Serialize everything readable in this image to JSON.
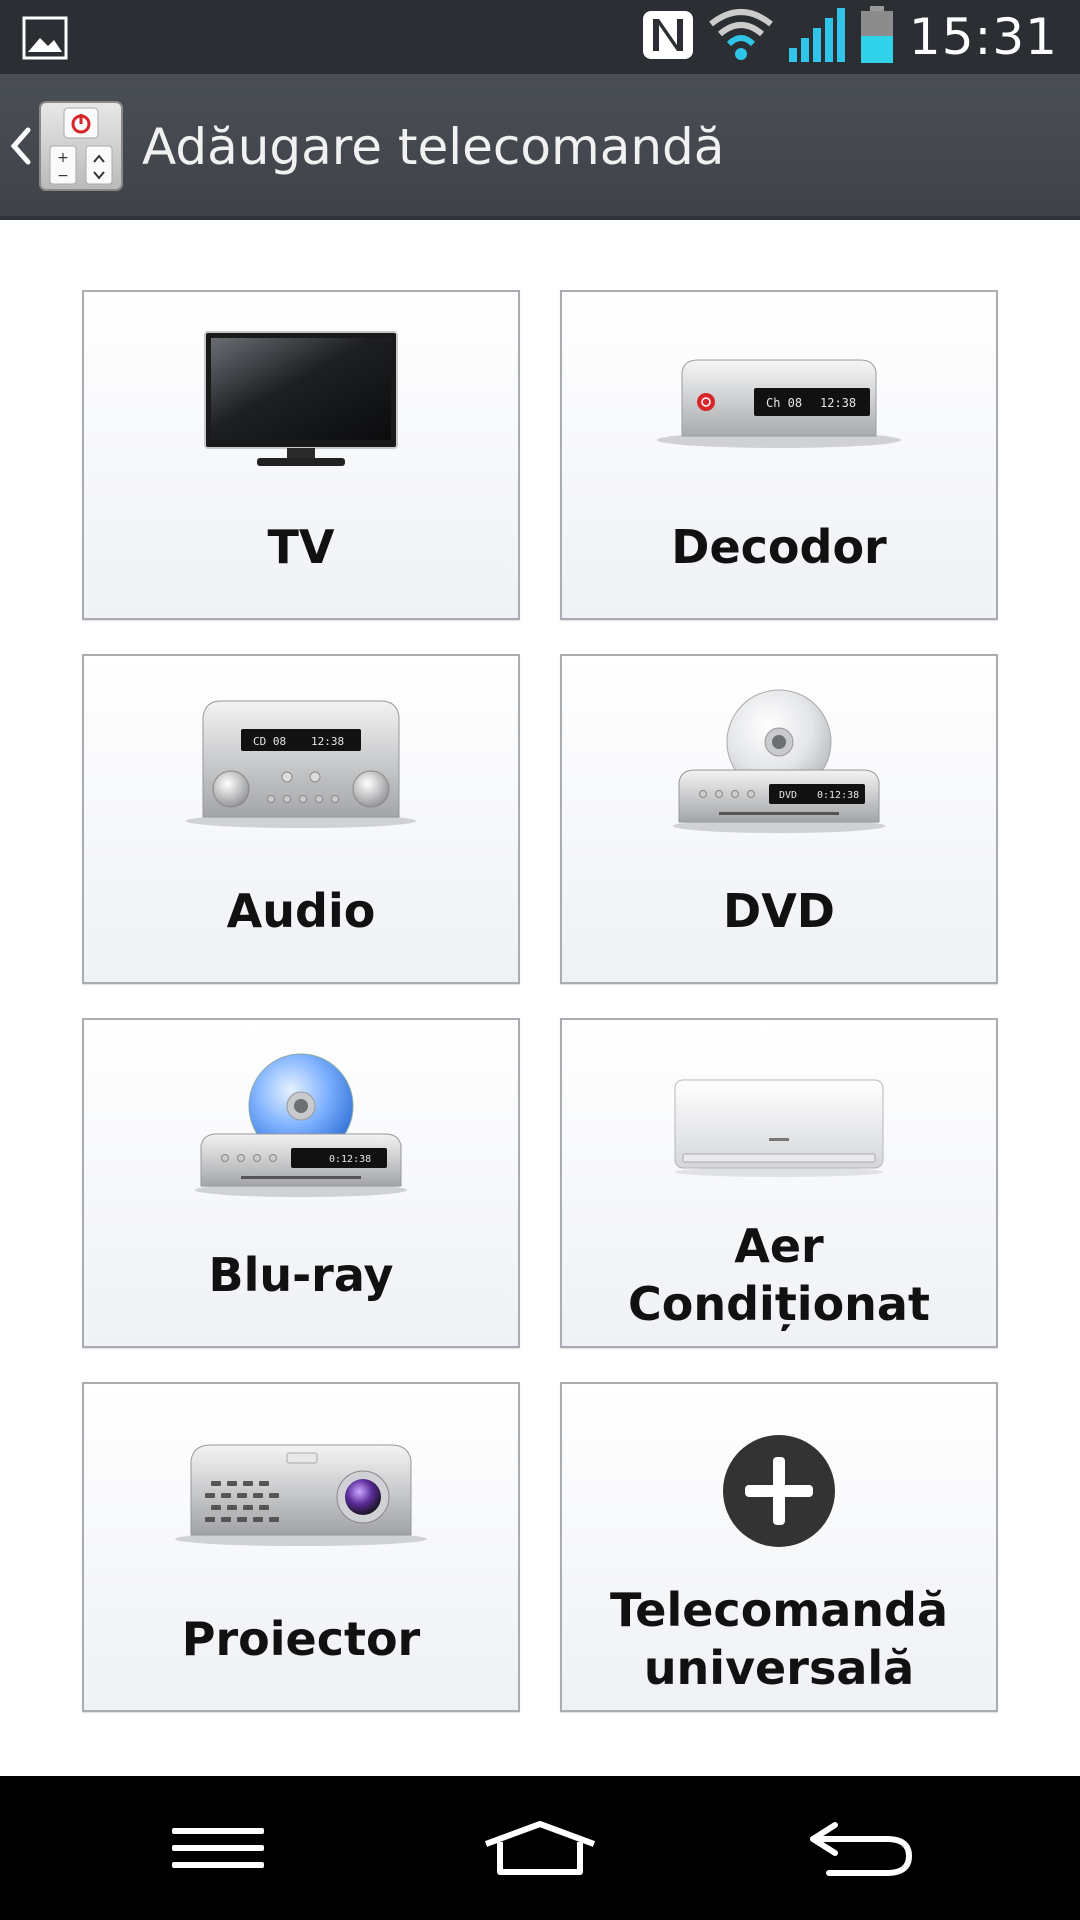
{
  "status_bar": {
    "time": "15:31",
    "icons": [
      "gallery-icon",
      "nfc-icon",
      "wifi-icon",
      "signal-icon",
      "battery-icon"
    ]
  },
  "action_bar": {
    "title": "Adăugare telecomandă"
  },
  "tiles": [
    {
      "label": "TV",
      "icon": "tv-icon"
    },
    {
      "label": "Decodor",
      "icon": "decoder-icon"
    },
    {
      "label": "Audio",
      "icon": "audio-icon"
    },
    {
      "label": "DVD",
      "icon": "dvd-icon"
    },
    {
      "label": "Blu-ray",
      "icon": "bluray-icon"
    },
    {
      "label": "Aer\nCondiționat",
      "label_lines": [
        "Aer",
        "Condiționat"
      ],
      "icon": "air-conditioner-icon"
    },
    {
      "label": "Proiector",
      "icon": "projector-icon"
    },
    {
      "label": "Telecomandă universală",
      "label_lines": [
        "Telecomandă",
        "universală"
      ],
      "icon": "plus-icon"
    }
  ],
  "device_displays": {
    "decoder": {
      "channel": "Ch 08",
      "clock": "12:38"
    },
    "audio": {
      "track": "CD 08",
      "clock": "12:38"
    },
    "dvd": {
      "mode": "DVD",
      "clock": "0:12:38"
    },
    "bluray": {
      "clock": "0:12:38"
    }
  },
  "nav_bar": {
    "buttons": [
      "menu-icon",
      "home-icon",
      "back-icon"
    ]
  },
  "colors": {
    "status_bar": "#2b2e32",
    "action_bar": "#44484e",
    "tile_border": "#a9acb1",
    "battery": "#2fd2e8",
    "signal": "#2fc4e8",
    "power_red": "#d7262b"
  }
}
